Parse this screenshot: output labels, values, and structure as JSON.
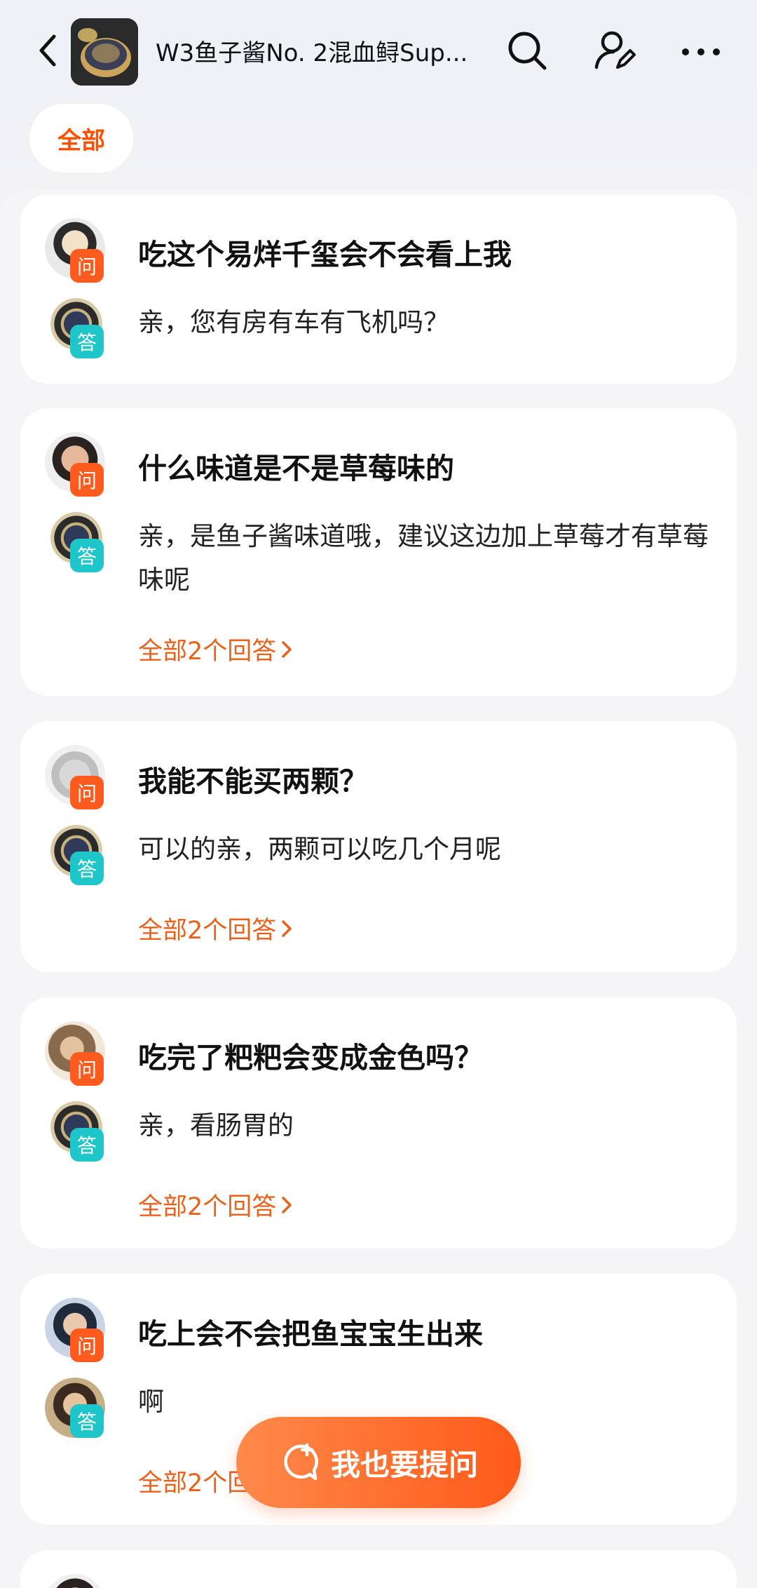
{
  "header": {
    "title": "W3鱼子酱No. 2混血鲟Sup...",
    "icons": [
      "back-arrow-icon",
      "search-icon",
      "profile-edit-icon",
      "more-icon"
    ]
  },
  "filter": {
    "label": "全部"
  },
  "badges": {
    "ask": "问",
    "answer": "答"
  },
  "qa_items": [
    {
      "question": "吃这个易烊千玺会不会看上我",
      "answer": "亲，您有房有车有飞机吗？",
      "more": ""
    },
    {
      "question": "什么味道是不是草莓味的",
      "answer": "亲，是鱼子酱味道哦，建议这边加上草莓才有草莓味呢",
      "more": "全部2个回答"
    },
    {
      "question": "我能不能买两颗？",
      "answer": "可以的亲，两颗可以吃几个月呢",
      "more": "全部2个回答"
    },
    {
      "question": "吃完了粑粑会变成金色吗？",
      "answer": "亲，看肠胃的",
      "more": "全部2个回答"
    },
    {
      "question": "吃上会不会把鱼宝宝生出来",
      "answer": "啊",
      "more": "全部2个回答"
    }
  ],
  "fab": {
    "label": "我也要提问"
  },
  "colors": {
    "accent": "#ff5000",
    "ask_badge": "#ff5b1f",
    "answer_badge": "#1fc6c9",
    "link": "#e8621c"
  }
}
